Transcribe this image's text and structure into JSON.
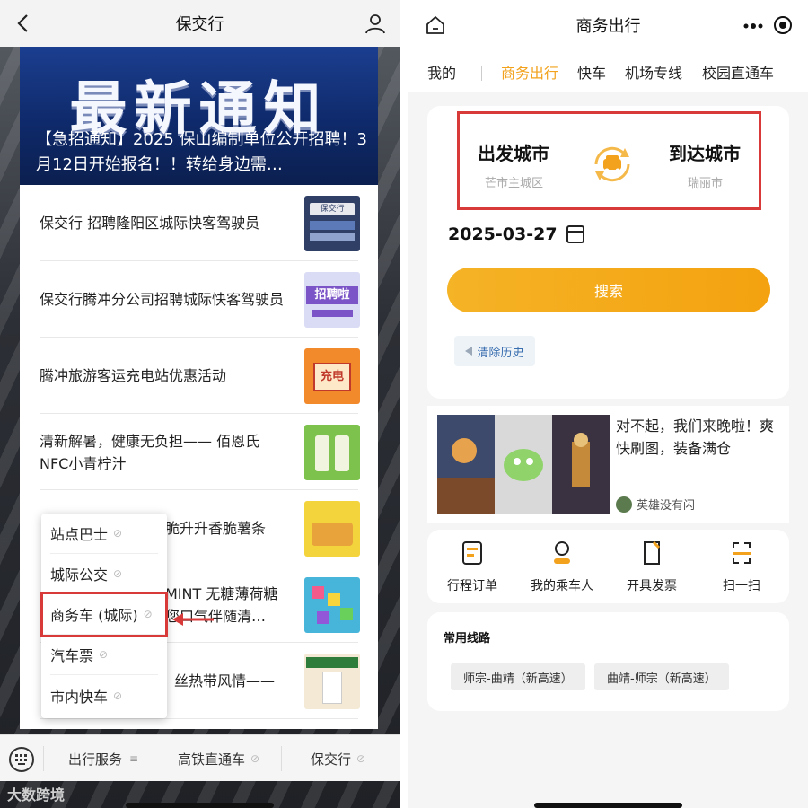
{
  "left": {
    "title": "保交行",
    "banner": {
      "big": "最新通知",
      "sub": "【急招通知】2025 保山编制单位公开招聘！3月12日开始报名！！转给身边需…"
    },
    "news": [
      {
        "text": "保交行 招聘隆阳区城际快客驾驶员"
      },
      {
        "text": "保交行腾冲分公司招聘城际快客驾驶员"
      },
      {
        "text": "腾冲旅游客运充电站优惠活动"
      },
      {
        "text": "清新解暑，健康无负担—— 佰恩氏NFC小青柠汁"
      },
      {
        "text": "脆升升香脆薯条"
      },
      {
        "text": "MINT 无糖薄荷糖您口气伴随清…"
      },
      {
        "text": "丝热带风情——"
      }
    ],
    "thumb_labels": {
      "t1": "保交行",
      "t2": "招聘啦",
      "t3": "充电"
    },
    "menu": [
      {
        "label": "站点巴士"
      },
      {
        "label": "城际公交"
      },
      {
        "label": "商务车 (城际)"
      },
      {
        "label": "汽车票"
      },
      {
        "label": "市内快车"
      }
    ],
    "bottom_bar": {
      "service": "出行服务",
      "rail": "高铁直通车",
      "brand": "保交行"
    },
    "watermark": "大数跨境"
  },
  "right": {
    "title": "商务出行",
    "tabs": [
      "我的",
      "商务出行",
      "快车",
      "机场专线",
      "校园直通车"
    ],
    "from_city": "出发城市",
    "from_sub": "芒市主城区",
    "to_city": "到达城市",
    "to_sub": "瑞丽市",
    "date": "2025-03-27",
    "search": "搜索",
    "clear_history": "清除历史",
    "ad": {
      "text": "对不起，我们来晚啦！爽快刷图，装备满仓",
      "author": "英雄没有闪"
    },
    "quick": [
      {
        "label": "行程订单"
      },
      {
        "label": "我的乘车人"
      },
      {
        "label": "开具发票"
      },
      {
        "label": "扫一扫"
      }
    ],
    "routes_title": "常用线路",
    "routes": [
      "师宗-曲靖（新高速）",
      "曲靖-师宗（新高速）"
    ],
    "accent": "#f2a21d"
  }
}
